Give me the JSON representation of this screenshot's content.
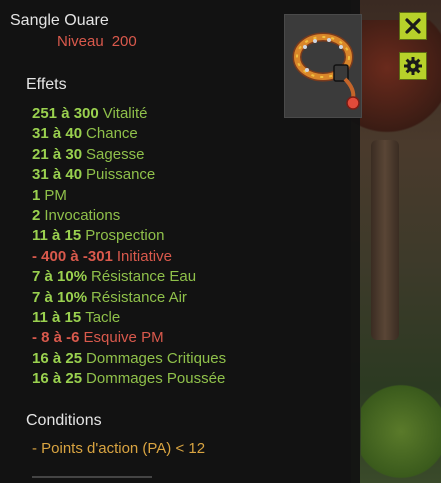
{
  "item": {
    "name": "Sangle Ouare",
    "level_label": "Niveau",
    "level_value": "200"
  },
  "effects_section": {
    "title": "Effets",
    "effects": [
      {
        "value": "251 à 300",
        "label": "Vitalité",
        "type": "positive"
      },
      {
        "value": "31 à 40",
        "label": "Chance",
        "type": "positive"
      },
      {
        "value": "21 à 30",
        "label": "Sagesse",
        "type": "positive"
      },
      {
        "value": "31 à 40",
        "label": "Puissance",
        "type": "positive"
      },
      {
        "value": "1",
        "label": "PM",
        "type": "positive"
      },
      {
        "value": "2",
        "label": "Invocations",
        "type": "positive"
      },
      {
        "value": "11 à 15",
        "label": "Prospection",
        "type": "positive"
      },
      {
        "value": "- 400 à -301",
        "label": "Initiative",
        "type": "negative"
      },
      {
        "value": "7 à 10%",
        "label": "Résistance Eau",
        "type": "positive"
      },
      {
        "value": "7 à 10%",
        "label": "Résistance Air",
        "type": "positive"
      },
      {
        "value": "11 à 15",
        "label": "Tacle",
        "type": "positive"
      },
      {
        "value": "- 8 à -6",
        "label": "Esquive PM",
        "type": "negative"
      },
      {
        "value": "16 à 25",
        "label": "Dommages Critiques",
        "type": "positive"
      },
      {
        "value": "16 à 25",
        "label": "Dommages Poussée",
        "type": "positive"
      }
    ]
  },
  "conditions_section": {
    "title": "Conditions",
    "condition": "- Points d'action (PA) < 12"
  },
  "item_icon": "belt-collar-icon",
  "buttons": {
    "close_icon": "close-icon",
    "settings_icon": "gear-icon"
  },
  "colors": {
    "positive": "#8fc04a",
    "negative": "#d9594c",
    "condition": "#d9a441",
    "button": "#b7d12a"
  }
}
